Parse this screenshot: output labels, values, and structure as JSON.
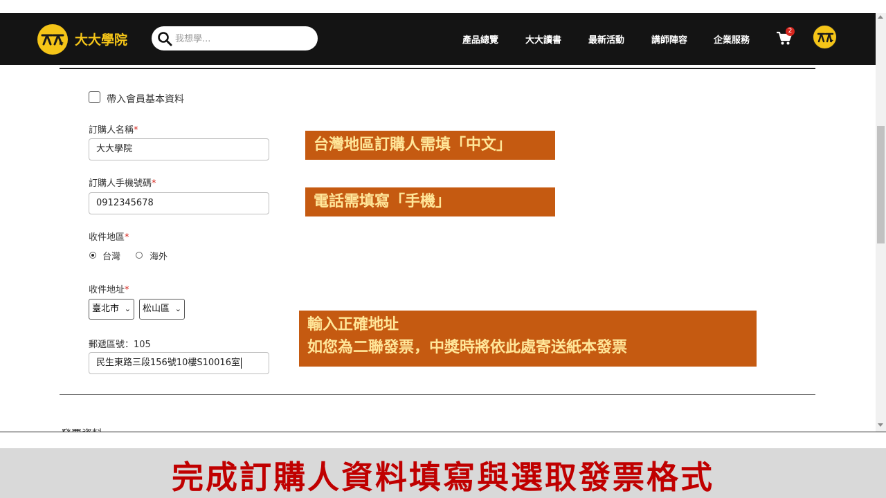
{
  "header": {
    "logo_text": "大大學院",
    "search_placeholder": "我想學...",
    "nav": [
      "產品總覽",
      "大大讀書",
      "最新活動",
      "講師陣容",
      "企業服務"
    ],
    "cart_count": "2"
  },
  "form": {
    "import_member_label": "帶入會員基本資料",
    "buyer_name_label": "訂購人名稱",
    "buyer_name_value": "大大學院",
    "buyer_phone_label": "訂購人手機號碼",
    "buyer_phone_value": "0912345678",
    "region_label": "收件地區",
    "region_options": [
      "台灣",
      "海外"
    ],
    "region_selected": "台灣",
    "address_label": "收件地址",
    "city": "臺北市",
    "district": "松山區",
    "postal_label": "郵遞區號：105",
    "address_value": "民生東路三段156號10樓S10016室",
    "next_section_label": "發票資料"
  },
  "callouts": {
    "name": "台灣地區訂購人需填「中文」",
    "phone": "電話需填寫「手機」",
    "address_line1": "輸入正確地址",
    "address_line2": "如您為二聯發票，中獎時將依此處寄送紙本發票"
  },
  "banner": {
    "text": "完成訂購人資料填寫與選取發票格式"
  },
  "colors": {
    "brand_yellow": "#f5c518",
    "nav_bg": "#141414",
    "callout_bg": "#c55a11",
    "callout_text": "#ffe699",
    "banner_text": "#c00000",
    "banner_bg": "#d9d9d9"
  }
}
